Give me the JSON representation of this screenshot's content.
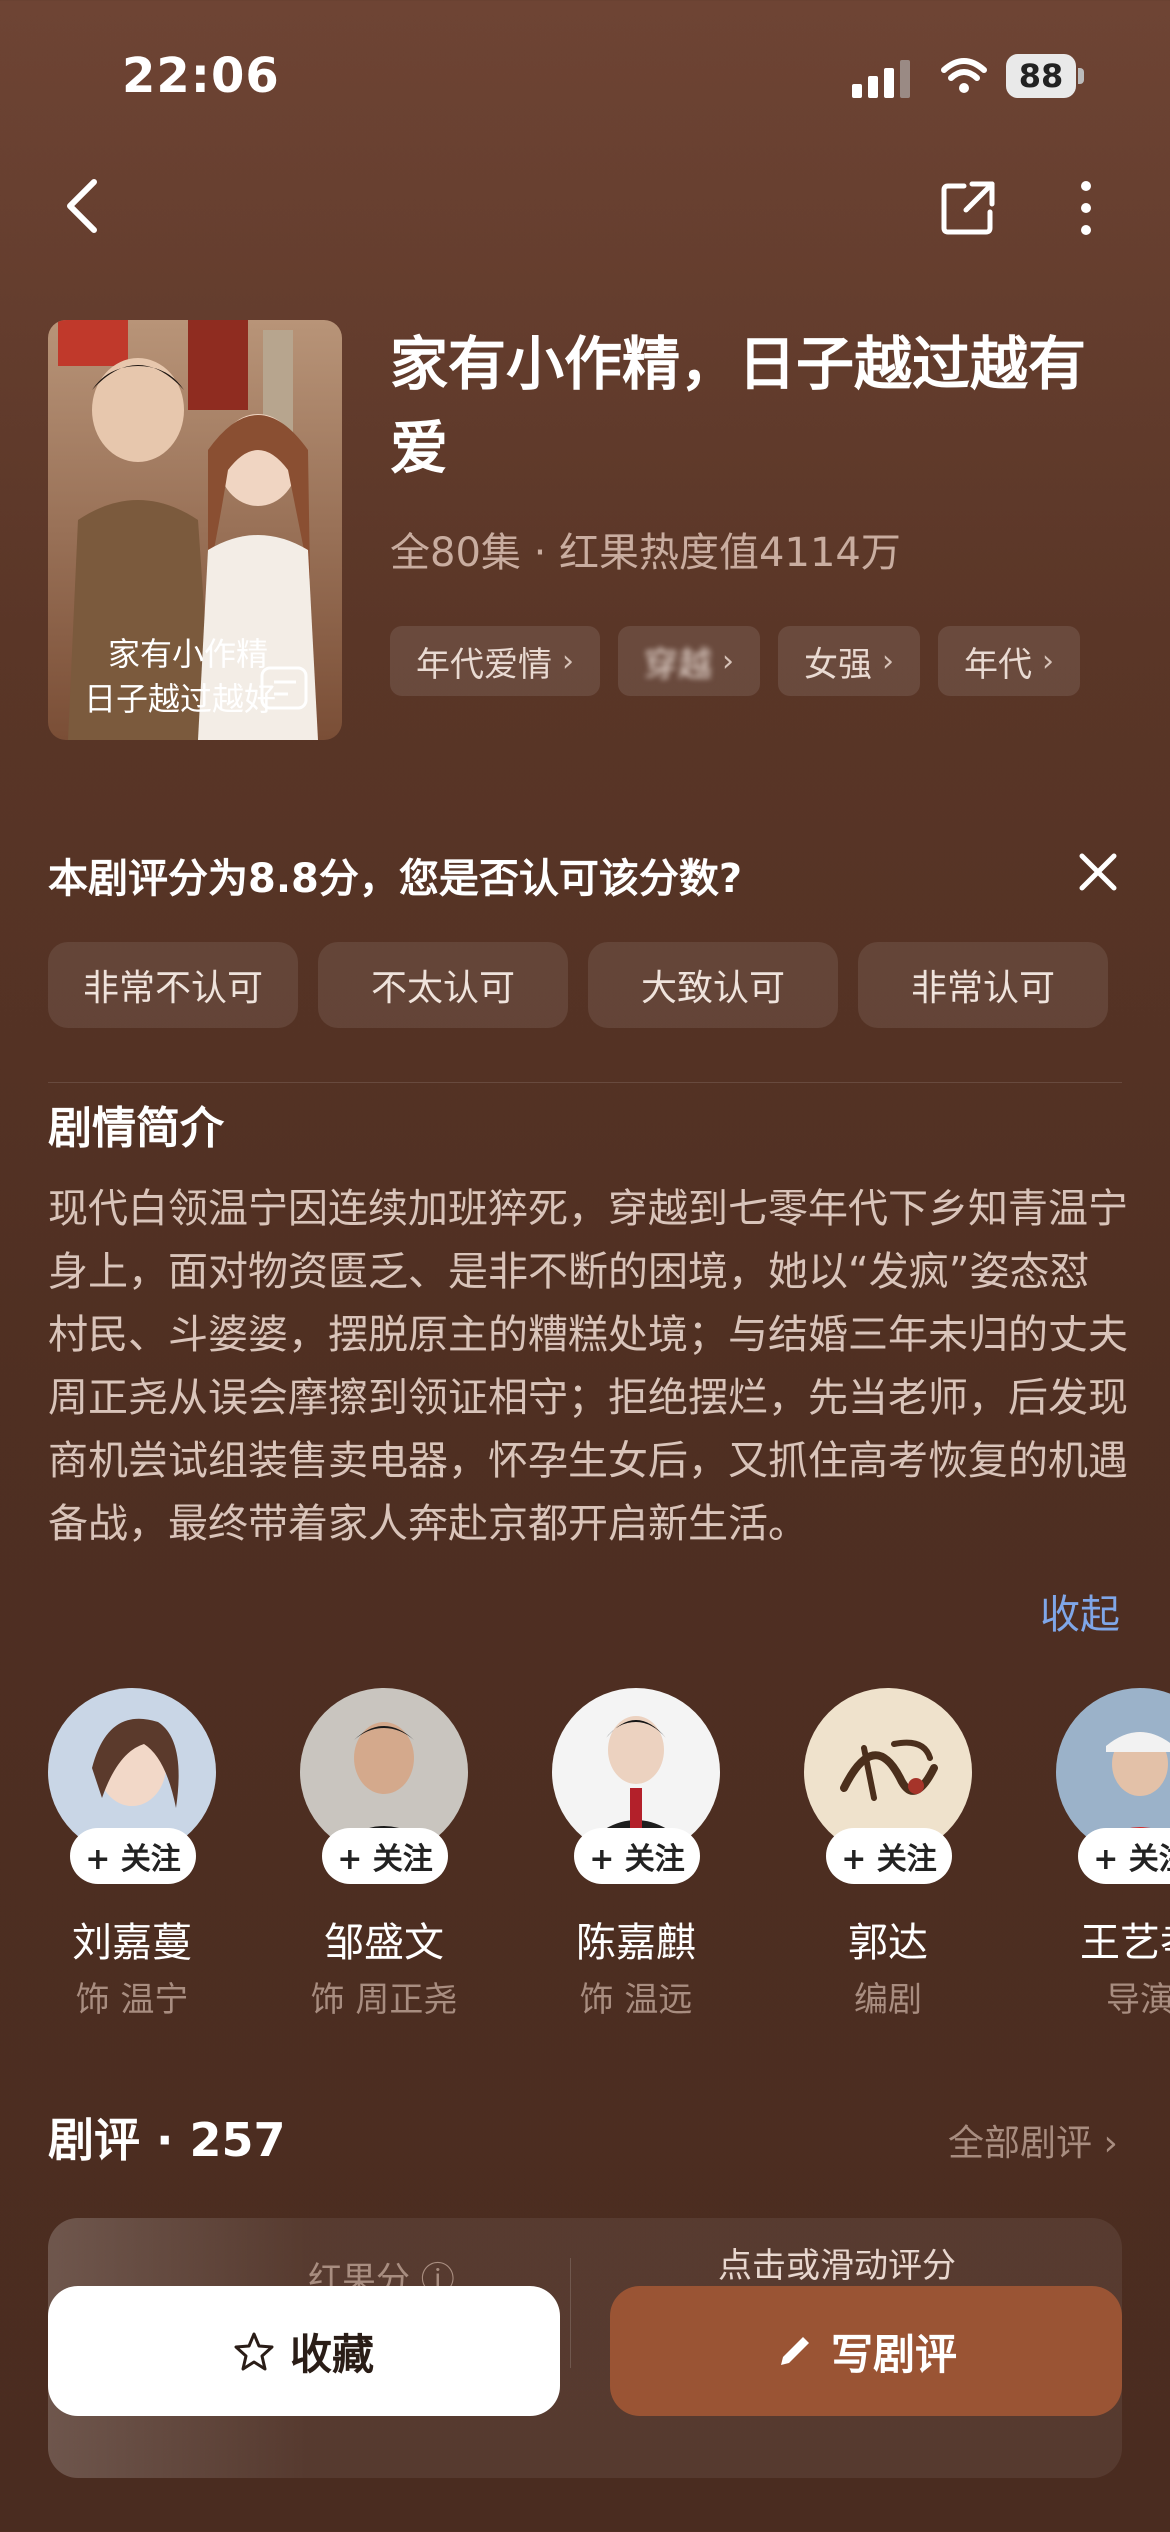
{
  "status_bar": {
    "time": "22:06",
    "battery": "88"
  },
  "show": {
    "title": "家有小作精，日子越过越有爱",
    "meta": "全80集 · 红果热度值4114万",
    "tags": [
      {
        "label": "年代爱情"
      },
      {
        "label": "穿越"
      },
      {
        "label": "女强"
      },
      {
        "label": "年代"
      }
    ],
    "poster_text": [
      "家有小作精",
      "日子越过越好"
    ]
  },
  "rating_prompt": {
    "question": "本剧评分为8.8分，您是否认可该分数?",
    "options": [
      "非常不认可",
      "不太认可",
      "大致认可",
      "非常认可"
    ]
  },
  "synopsis": {
    "title": "剧情简介",
    "text": "现代白领温宁因连续加班猝死，穿越到七零年代下乡知青温宁身上，面对物资匮乏、是非不断的困境，她以“发疯”姿态怼村民、斗婆婆，摆脱原主的糟糕处境；与结婚三年未归的丈夫周正尧从误会摩擦到领证相守；拒绝摆烂，先当老师，后发现商机尝试组装售卖电器，怀孕生女后，又抓住高考恢复的机遇备战，最终带着家人奔赴京都开启新生活。",
    "collapse_label": "收起"
  },
  "cast": {
    "follow_label": "+ 关注",
    "members": [
      {
        "name": "刘嘉蔓",
        "role": "饰 温宁"
      },
      {
        "name": "邹盛文",
        "role": "饰 周正尧"
      },
      {
        "name": "陈嘉麒",
        "role": "饰 温远"
      },
      {
        "name": "郭达",
        "role": "编剧"
      },
      {
        "name": "王艺孝",
        "role": "导演"
      }
    ]
  },
  "reviews": {
    "title": "剧评 · 257",
    "all_label": "全部剧评 ›",
    "score_label": "红果分 ⓘ",
    "tap_label": "点击或滑动评分"
  },
  "actions": {
    "favorite": "收藏",
    "write": "写剧评"
  }
}
